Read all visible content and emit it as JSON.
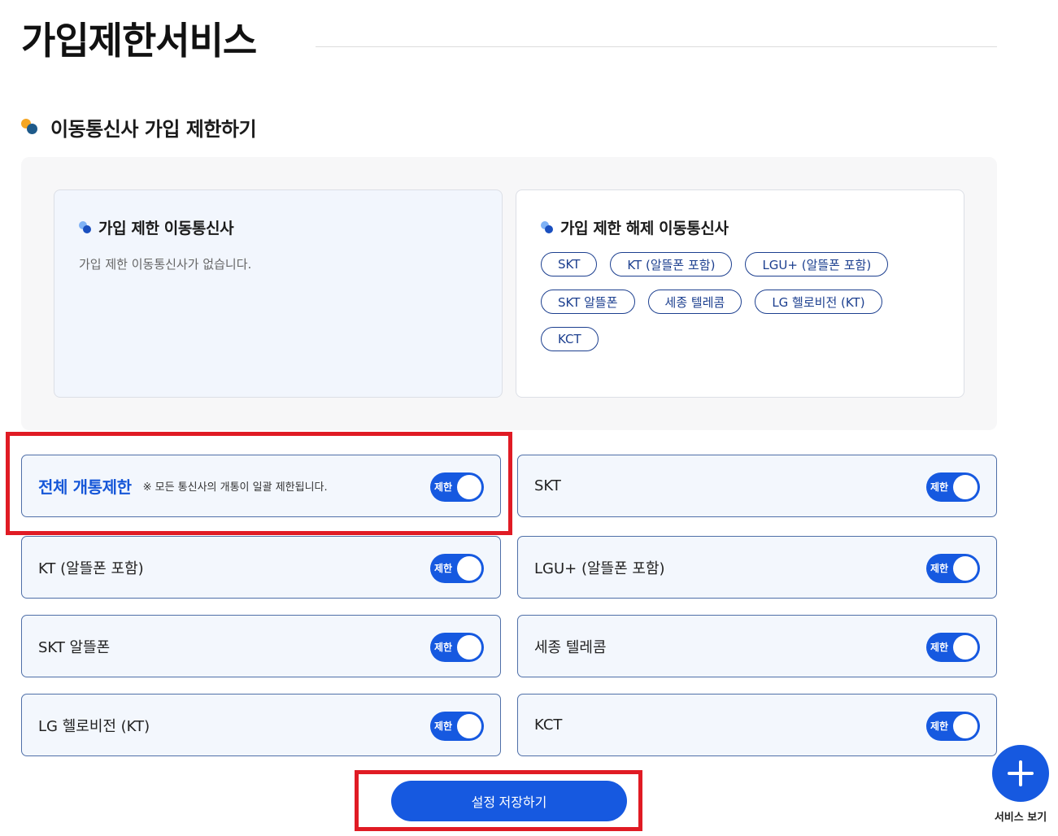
{
  "page": {
    "title": "가입제한서비스"
  },
  "section": {
    "title": "이동통신사 가입 제한하기"
  },
  "restricted_panel": {
    "title": "가입 제한 이동통신사",
    "empty_text": "가입 제한 이동통신사가 없습니다."
  },
  "unrestricted_panel": {
    "title": "가입 제한 해제 이동통신사",
    "carriers": [
      "SKT",
      "KT (알뜰폰 포함)",
      "LGU+ (알뜰폰 포함)",
      "SKT 알뜰폰",
      "세종 텔레콤",
      "LG 헬로비전 (KT)",
      "KCT"
    ]
  },
  "toggles": {
    "switch_label": "제한",
    "all": {
      "label": "전체 개통제한",
      "note": "※ 모든 통신사의 개통이 일괄 제한됩니다."
    },
    "skt": {
      "label": "SKT"
    },
    "kt": {
      "label": "KT (알뜰폰 포함)"
    },
    "lgu": {
      "label": "LGU+ (알뜰폰 포함)"
    },
    "skt_mvno": {
      "label": "SKT 알뜰폰"
    },
    "sejong": {
      "label": "세종 텔레콤"
    },
    "lg_hello": {
      "label": "LG 헬로비전 (KT)"
    },
    "kct": {
      "label": "KCT"
    }
  },
  "actions": {
    "save_label": "설정 저장하기"
  },
  "fab": {
    "label": "서비스 보기",
    "icon": "plus-icon"
  },
  "colors": {
    "primary": "#1659e0",
    "highlight": "#e01b24",
    "chip_border": "#1c3f8f"
  }
}
